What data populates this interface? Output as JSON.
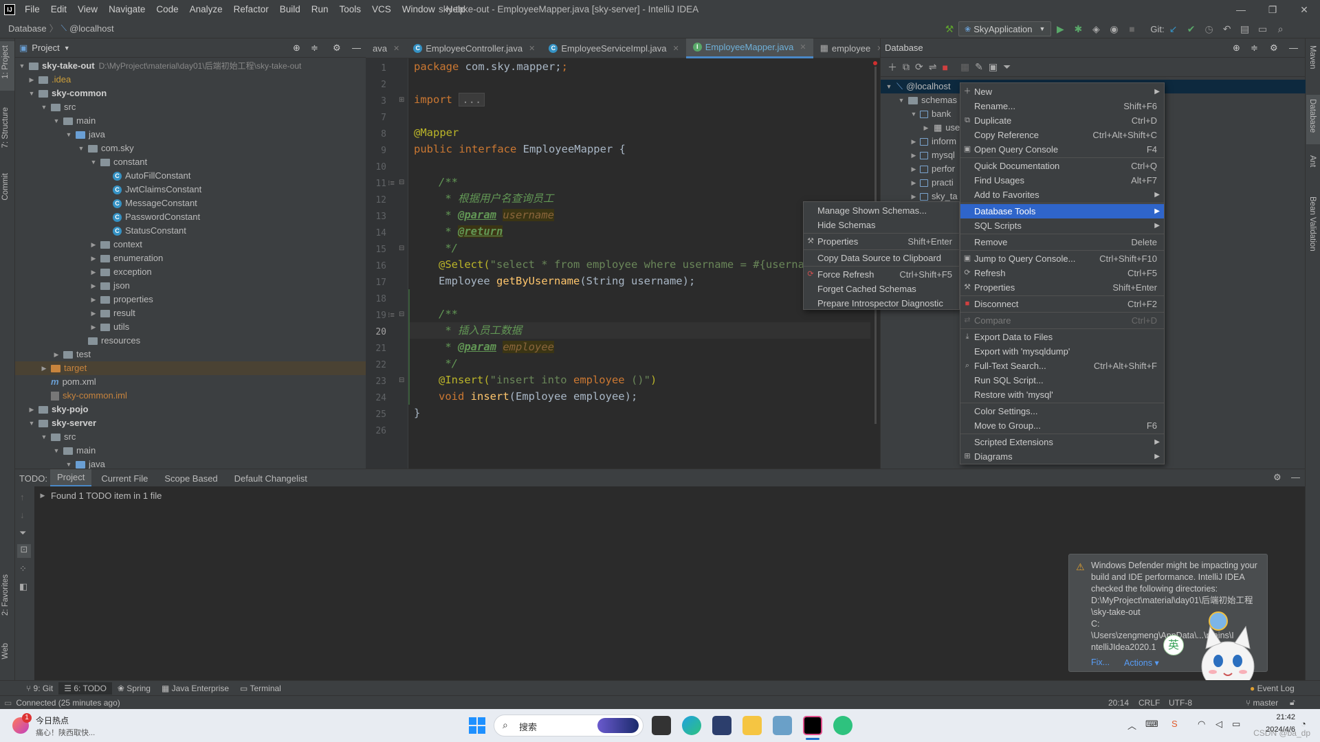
{
  "menubar": [
    "File",
    "Edit",
    "View",
    "Navigate",
    "Code",
    "Analyze",
    "Refactor",
    "Build",
    "Run",
    "Tools",
    "VCS",
    "Window",
    "Help"
  ],
  "window_title": "sky-take-out - EmployeeMapper.java [sky-server] - IntelliJ IDEA",
  "breadcrumb": {
    "first": "Database",
    "second": "@localhost"
  },
  "run_config": "SkyApplication",
  "git_label": "Git:",
  "left_stripe": {
    "project": "1: Project",
    "structure": "7: Structure",
    "commit": "Commit",
    "favorites": "2: Favorites",
    "web": "Web"
  },
  "right_stripe": {
    "maven": "Maven",
    "database": "Database",
    "ant": "Ant",
    "bean": "Bean Validation"
  },
  "project_panel": {
    "title": "Project",
    "tree": [
      {
        "label": "sky-take-out",
        "extra": "D:\\MyProject\\material\\day01\\后端初始工程\\sky-take-out"
      },
      {
        "label": ".idea"
      },
      {
        "label": "sky-common"
      },
      {
        "label": "src"
      },
      {
        "label": "main"
      },
      {
        "label": "java"
      },
      {
        "label": "com.sky"
      },
      {
        "label": "constant"
      },
      {
        "label": "AutoFillConstant"
      },
      {
        "label": "JwtClaimsConstant"
      },
      {
        "label": "MessageConstant"
      },
      {
        "label": "PasswordConstant"
      },
      {
        "label": "StatusConstant"
      },
      {
        "label": "context"
      },
      {
        "label": "enumeration"
      },
      {
        "label": "exception"
      },
      {
        "label": "json"
      },
      {
        "label": "properties"
      },
      {
        "label": "result"
      },
      {
        "label": "utils"
      },
      {
        "label": "resources"
      },
      {
        "label": "test"
      },
      {
        "label": "target"
      },
      {
        "label": "pom.xml"
      },
      {
        "label": "sky-common.iml"
      },
      {
        "label": "sky-pojo"
      },
      {
        "label": "sky-server"
      },
      {
        "label": "src"
      },
      {
        "label": "main"
      },
      {
        "label": "java"
      }
    ]
  },
  "editor": {
    "tabs": [
      {
        "label": "ava"
      },
      {
        "label": "EmployeeController.java"
      },
      {
        "label": "EmployeeServiceImpl.java"
      },
      {
        "label": "EmployeeMapper.java"
      },
      {
        "label": "employee"
      }
    ],
    "line_numbers": [
      "1",
      "2",
      "3",
      "7",
      "8",
      "9",
      "10",
      "11",
      "12",
      "13",
      "14",
      "15",
      "16",
      "17",
      "18",
      "19",
      "20",
      "21",
      "22",
      "23",
      "24",
      "25",
      "26"
    ],
    "code": {
      "l1_kw": "package",
      "l1_rest": " com.sky.mapper;",
      "l3_kw": "import",
      "l3_fold": "...",
      "l8": "@Mapper",
      "l9_kw": "public interface",
      "l9_rest": " EmployeeMapper {",
      "l11": "/**",
      "l12": " * 根据用户名查询员工",
      "l13_star": " * ",
      "l13_tag": "@param",
      "l13_name": "username",
      "l14_star": " * ",
      "l14_tag": "@return",
      "l15": " */",
      "l16_ann": "@Select(",
      "l16_str": "\"select * from employee where username = #{username",
      "l17_type": "Employee ",
      "l17_fn": "getByUsername",
      "l17_rest": "(String username);",
      "l19": "/**",
      "l20": " * 插入员工数据",
      "l21_star": " * ",
      "l21_tag": "@param",
      "l21_name": "employee",
      "l22": " */",
      "l23_ann": "@Insert(",
      "l23_str1": "\"insert into ",
      "l23_tbl": "employee",
      "l23_str2": " ()\"",
      "l23_close": ")",
      "l24_kw": "void ",
      "l24_fn": "insert",
      "l24_rest": "(Employee employee);",
      "l25": "}"
    }
  },
  "database_panel": {
    "title": "Database",
    "tree": [
      "@localhost",
      "schemas",
      "bank",
      "use",
      "inform",
      "mysql",
      "perfor",
      "practi",
      "sky_ta"
    ]
  },
  "context_menu": [
    {
      "label": "New",
      "shortcut": "",
      "submenu": true
    },
    {
      "label": "Rename...",
      "shortcut": "Shift+F6"
    },
    {
      "label": "Duplicate",
      "shortcut": "Ctrl+D"
    },
    {
      "label": "Copy Reference",
      "shortcut": "Ctrl+Alt+Shift+C"
    },
    {
      "label": "Open Query Console",
      "shortcut": "F4"
    },
    {
      "label": "Quick Documentation",
      "shortcut": "Ctrl+Q"
    },
    {
      "label": "Find Usages",
      "shortcut": "Alt+F7"
    },
    {
      "label": "Add to Favorites",
      "shortcut": "",
      "submenu": true
    },
    {
      "label": "Database Tools",
      "shortcut": "",
      "submenu": true
    },
    {
      "label": "SQL Scripts",
      "shortcut": "",
      "submenu": true
    },
    {
      "label": "Remove",
      "shortcut": "Delete"
    },
    {
      "label": "Jump to Query Console...",
      "shortcut": "Ctrl+Shift+F10"
    },
    {
      "label": "Refresh",
      "shortcut": "Ctrl+F5"
    },
    {
      "label": "Properties",
      "shortcut": "Shift+Enter"
    },
    {
      "label": "Disconnect",
      "shortcut": "Ctrl+F2"
    },
    {
      "label": "Compare",
      "shortcut": "Ctrl+D"
    },
    {
      "label": "Export Data to Files",
      "shortcut": ""
    },
    {
      "label": "Export with 'mysqldump'",
      "shortcut": ""
    },
    {
      "label": "Full-Text Search...",
      "shortcut": "Ctrl+Alt+Shift+F"
    },
    {
      "label": "Run SQL Script...",
      "shortcut": ""
    },
    {
      "label": "Restore with 'mysql'",
      "shortcut": ""
    },
    {
      "label": "Color Settings...",
      "shortcut": ""
    },
    {
      "label": "Move to Group...",
      "shortcut": "F6"
    },
    {
      "label": "Scripted Extensions",
      "shortcut": "",
      "submenu": true
    },
    {
      "label": "Diagrams",
      "shortcut": "",
      "submenu": true
    }
  ],
  "submenu": [
    {
      "label": "Manage Shown Schemas...",
      "shortcut": ""
    },
    {
      "label": "Hide Schemas",
      "shortcut": ""
    },
    {
      "label": "Properties",
      "shortcut": "Shift+Enter"
    },
    {
      "label": "Copy Data Source to Clipboard",
      "shortcut": ""
    },
    {
      "label": "Force Refresh",
      "shortcut": "Ctrl+Shift+F5"
    },
    {
      "label": "Forget Cached Schemas",
      "shortcut": ""
    },
    {
      "label": "Prepare Introspector Diagnostic",
      "shortcut": ""
    }
  ],
  "todo": {
    "label": "TODO:",
    "tabs": [
      "Project",
      "Current File",
      "Scope Based",
      "Default Changelist"
    ],
    "result": "Found 1 TODO item in 1 file"
  },
  "tool_tabs": [
    "9: Git",
    "6: TODO",
    "Spring",
    "Java Enterprise",
    "Terminal"
  ],
  "event_log": "Event Log",
  "status": {
    "left": "Connected (25 minutes ago)",
    "pos": "20:14",
    "eol": "CRLF",
    "enc": "UTF-8",
    "branch": "master"
  },
  "notification": {
    "lines": [
      "Windows Defender might be impacting your",
      "build and IDE performance. IntelliJ IDEA",
      "checked the following directories:",
      "D:\\MyProject\\material\\day01\\后端初始工程",
      "\\sky-take-out",
      "C:",
      "\\Users\\zengmeng\\AppData\\...\\mains\\I",
      "ntelliJIdea2020.1"
    ],
    "fix": "Fix...",
    "actions": "Actions"
  },
  "taskbar": {
    "news_title": "今日热点",
    "news_sub": "痛心！陕西取快...",
    "badge": "1",
    "search": "搜索",
    "time": "21:42",
    "date": "2024/4/6",
    "ime": "英",
    "watermark": "CSDN @ba_dp"
  },
  "colors": {
    "accent": "#2f65ca",
    "active_tab": "#4a88c7",
    "bg": "#2b2b2b",
    "panel": "#3c3f41"
  }
}
